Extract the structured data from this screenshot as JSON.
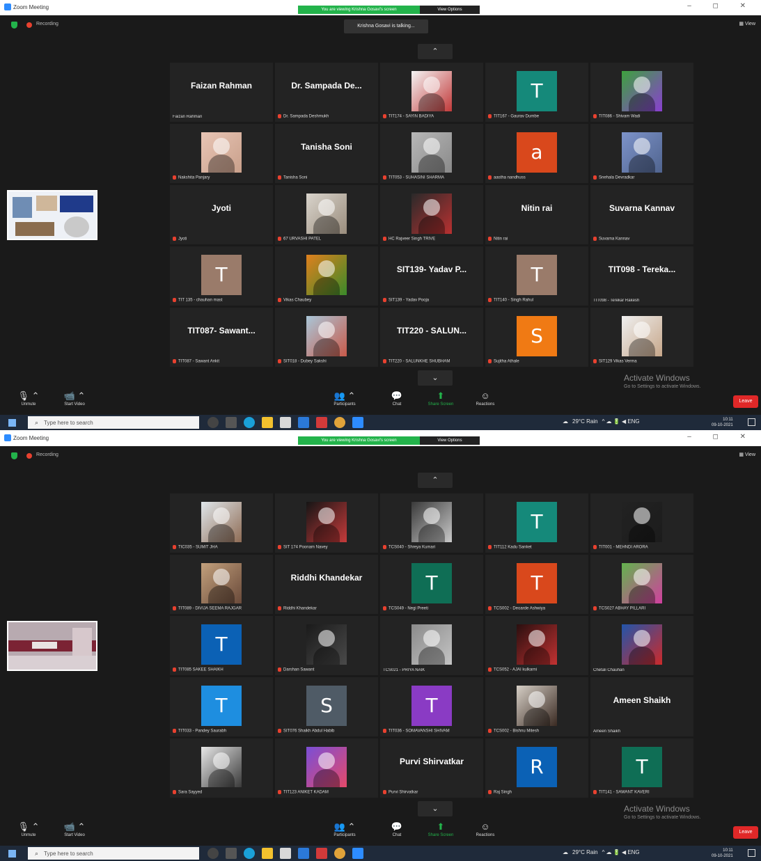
{
  "colors": {
    "tile_bg": "#232323",
    "window_bg": "#1a1a1a",
    "share_green": "#23b34b",
    "leave_red": "#e02828",
    "mic_off_red": "#e8412f"
  },
  "common": {
    "app_title": "Zoom Meeting",
    "share_banner": "You are viewing Krishna Gosavi's screen",
    "view_options": "View Options",
    "window_controls": "– ◻ ✕",
    "recording": "Recording",
    "view_label": "View",
    "activate_title": "Activate Windows",
    "activate_sub": "Go to Settings to activate Windows.",
    "controls": {
      "unmute": "Unmute",
      "start_video": "Start Video",
      "participants": "Participants",
      "chat": "Chat",
      "share_screen": "Share Screen",
      "reactions": "Reactions",
      "leave": "Leave"
    },
    "search_placeholder": "Type here to search",
    "weather": "29°C Rain",
    "tray_icons": "^ ☁ 🔋 ◀ ENG",
    "clock_time": "10:11",
    "clock_date": "09-10-2021"
  },
  "screens": [
    {
      "talking": "Krishna Gosavi is talking...",
      "arrow": "⌃",
      "bottom_arrow": "⌄",
      "tiles": [
        {
          "kind": "text",
          "big": "Faizan Rahman",
          "label": "Faizan Rahman",
          "muted": false
        },
        {
          "kind": "text",
          "big": "Dr. Sampada De...",
          "label": "Dr. Sampada Deshmukh",
          "muted": true
        },
        {
          "kind": "photo",
          "photo_colors": [
            "#f4f4f4",
            "#c23a3a"
          ],
          "label": "TIT174 - SAYIN BADIYA",
          "muted": true
        },
        {
          "kind": "avatar",
          "letter": "T",
          "color": "#15897a",
          "label": "TIT167 - Gaurav Dumbe",
          "muted": true
        },
        {
          "kind": "photo",
          "photo_colors": [
            "#3da23d",
            "#8a3fd1"
          ],
          "label": "TIT086 - Shivam Wadi",
          "muted": true
        },
        {
          "kind": "photo",
          "photo_colors": [
            "#e8c5b5",
            "#c9a08b"
          ],
          "label": "Nakshita Panjary",
          "muted": true
        },
        {
          "kind": "text",
          "big": "Tanisha Soni",
          "label": "Tanisha Soni",
          "muted": true
        },
        {
          "kind": "photo",
          "photo_colors": [
            "#b7b7b7",
            "#8a8a8a"
          ],
          "label": "TIT053 - SUHASINI SHARMA",
          "muted": true
        },
        {
          "kind": "avatar",
          "letter": "a",
          "color": "#d9481c",
          "label": "aastha nandhuss",
          "muted": true
        },
        {
          "kind": "photo",
          "photo_colors": [
            "#7d93c9",
            "#50648f"
          ],
          "label": "Snehala Devradkar",
          "muted": true
        },
        {
          "kind": "text",
          "big": "Jyoti",
          "label": "Jyoti",
          "muted": true
        },
        {
          "kind": "photo",
          "photo_colors": [
            "#d9d4cc",
            "#9a8d7d"
          ],
          "label": "67 URVASHI PATEL",
          "muted": true
        },
        {
          "kind": "photo",
          "photo_colors": [
            "#2a2a2a",
            "#b93131"
          ],
          "label": "HC Rajveer Singh TRIVE",
          "muted": true
        },
        {
          "kind": "text",
          "big": "Nitin rai",
          "label": "Nitin rai",
          "muted": true
        },
        {
          "kind": "text",
          "big": "Suvarna Kannav",
          "label": "Suvarna Kannav",
          "muted": true
        },
        {
          "kind": "avatar",
          "letter": "T",
          "color": "#9a7b6a",
          "label": "TIT 135 - chauhan mast",
          "muted": true
        },
        {
          "kind": "photo",
          "photo_colors": [
            "#e0801d",
            "#3a8a2a"
          ],
          "label": "Vikas Chaubey",
          "muted": true
        },
        {
          "kind": "text",
          "big": "SIT139- Yadav P...",
          "label": "SIT139 - Yadav Pooja",
          "muted": true
        },
        {
          "kind": "avatar",
          "letter": "T",
          "color": "#9a7b6a",
          "label": "TIT140 - Singh Rahul",
          "muted": true
        },
        {
          "kind": "text",
          "big": "TIT098 - Tereka...",
          "label": "TIT098 - Terekar Rakesh",
          "muted": false
        },
        {
          "kind": "text",
          "big": "TIT087- Sawant...",
          "label": "TIT087 - Sawant Ankit",
          "muted": true
        },
        {
          "kind": "photo",
          "photo_colors": [
            "#a9c6d8",
            "#c85a4a"
          ],
          "label": "SIT018 - Dubey Sakshi",
          "muted": true
        },
        {
          "kind": "text",
          "big": "TIT220 - SALUN...",
          "label": "TIT220 - SALUNKHE SHUBHAM",
          "muted": true
        },
        {
          "kind": "avatar",
          "letter": "S",
          "color": "#f07a14",
          "label": "Sujitha Athale",
          "muted": true
        },
        {
          "kind": "photo",
          "photo_colors": [
            "#efefef",
            "#c7a78a"
          ],
          "label": "SIT129 Vikas Verma",
          "muted": true
        }
      ]
    },
    {
      "talking": "",
      "arrow": "⌃",
      "bottom_arrow": "⌄",
      "tiles": [
        {
          "kind": "photo",
          "photo_colors": [
            "#dfe6ea",
            "#8f6c55"
          ],
          "label": "TIC035 - SUMIT JHA",
          "muted": true
        },
        {
          "kind": "photo",
          "photo_colors": [
            "#151515",
            "#c63b3b"
          ],
          "label": "SIT 174 Poonam Navey",
          "muted": true
        },
        {
          "kind": "photo",
          "photo_colors": [
            "#3a3a3a",
            "#c9c9c9"
          ],
          "label": "TCS040 - Shreya Kumari",
          "muted": true
        },
        {
          "kind": "avatar",
          "letter": "T",
          "color": "#15897a",
          "label": "TIT112 Kadu Sanket",
          "muted": true
        },
        {
          "kind": "photo",
          "photo_colors": [
            "#222222",
            "#1c1c1c"
          ],
          "label": "TIT001 - MEHNDI ARORA",
          "muted": true
        },
        {
          "kind": "photo",
          "photo_colors": [
            "#c2a07c",
            "#6a4a3a"
          ],
          "label": "TIT089 - DIVIJA SEEMA RAJGAR",
          "muted": true
        },
        {
          "kind": "text",
          "big": "Riddhi Khandekar",
          "label": "Riddhi Khandekar",
          "muted": true
        },
        {
          "kind": "avatar",
          "letter": "T",
          "color": "#0f6e55",
          "label": "TCS049 - Negi Preeti",
          "muted": true
        },
        {
          "kind": "avatar",
          "letter": "T",
          "color": "#d9481c",
          "label": "TCS002 - Deoarde Ashwiya",
          "muted": true
        },
        {
          "kind": "photo",
          "photo_colors": [
            "#62b34d",
            "#d13f9f"
          ],
          "label": "TCS027 ABHAY PILLARI",
          "muted": true
        },
        {
          "kind": "avatar",
          "letter": "T",
          "color": "#0b61b5",
          "label": "TIT085 SAKEE SHAIKH",
          "muted": true
        },
        {
          "kind": "photo",
          "photo_colors": [
            "#1a1a1a",
            "#4a4a4a"
          ],
          "label": "Darshan Sawant",
          "muted": true
        },
        {
          "kind": "photo",
          "photo_colors": [
            "#8a8a8a",
            "#c4c4c4"
          ],
          "label": "TCS021 - PRIYA NAIK",
          "muted": false
        },
        {
          "kind": "photo",
          "photo_colors": [
            "#2a0f0f",
            "#c23232"
          ],
          "label": "TCS052 - AJAI kulkarni",
          "muted": true
        },
        {
          "kind": "photo",
          "photo_colors": [
            "#2255aa",
            "#cc2a2a"
          ],
          "label": "Chetali Chauhan",
          "muted": false
        },
        {
          "kind": "avatar",
          "letter": "T",
          "color": "#1e8ee0",
          "label": "TIT033 - Pandey Saurabh",
          "muted": true
        },
        {
          "kind": "avatar",
          "letter": "S",
          "color": "#4f5b66",
          "label": "SIT076 Shaikh Abdul Habib",
          "muted": true
        },
        {
          "kind": "avatar",
          "letter": "T",
          "color": "#8a3bc4",
          "label": "TIT036 - SOMAVANSHI SHIVAM",
          "muted": true
        },
        {
          "kind": "photo",
          "photo_colors": [
            "#d6cfc6",
            "#3a2a22"
          ],
          "label": "TCS002 - Bishnu Mitesh",
          "muted": true
        },
        {
          "kind": "text",
          "big": "Ameen Shaikh",
          "label": "Ameen Shaikh",
          "muted": false
        },
        {
          "kind": "photo",
          "photo_colors": [
            "#e7e7e7",
            "#3a3a3a"
          ],
          "label": "Sara Sayyed",
          "muted": true
        },
        {
          "kind": "photo",
          "photo_colors": [
            "#7a4ed6",
            "#e54a6a"
          ],
          "label": "TIT123 ANIKET KADAM",
          "muted": true
        },
        {
          "kind": "text",
          "big": "Purvi Shirvatkar",
          "label": "Purvi Shirvatkar",
          "muted": true
        },
        {
          "kind": "avatar",
          "letter": "R",
          "color": "#0b61b5",
          "label": "Raj Singh",
          "muted": true
        },
        {
          "kind": "avatar",
          "letter": "T",
          "color": "#0f6e55",
          "label": "TIT141 - SAWANT KAVERI",
          "muted": true
        }
      ]
    }
  ]
}
